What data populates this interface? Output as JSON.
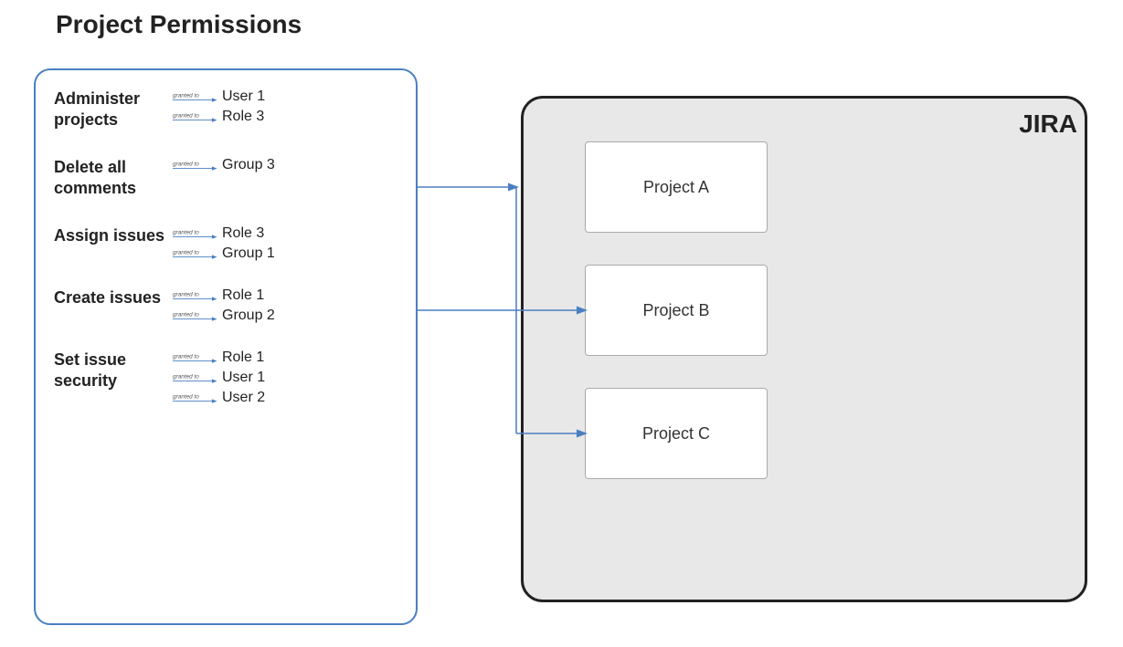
{
  "title": "Project Permissions",
  "jira_label": "JIRA",
  "permissions": [
    {
      "name": "Administer projects",
      "grants": [
        {
          "label": "granted to",
          "target": "User 1"
        },
        {
          "label": "granted to",
          "target": "Role 3"
        }
      ]
    },
    {
      "name": "Delete all comments",
      "grants": [
        {
          "label": "granted to",
          "target": "Group 3"
        }
      ]
    },
    {
      "name": "Assign issues",
      "grants": [
        {
          "label": "granted to",
          "target": "Role 3"
        },
        {
          "label": "granted to",
          "target": "Group 1"
        }
      ]
    },
    {
      "name": "Create issues",
      "grants": [
        {
          "label": "granted to",
          "target": "Role 1"
        },
        {
          "label": "granted to",
          "target": "Group 2"
        }
      ]
    },
    {
      "name": "Set issue security",
      "grants": [
        {
          "label": "granted to",
          "target": "Role 1"
        },
        {
          "label": "granted to",
          "target": "User 1"
        },
        {
          "label": "granted to",
          "target": "User 2"
        }
      ]
    }
  ],
  "projects": [
    {
      "name": "Project A"
    },
    {
      "name": "Project B"
    },
    {
      "name": "Project C"
    }
  ]
}
